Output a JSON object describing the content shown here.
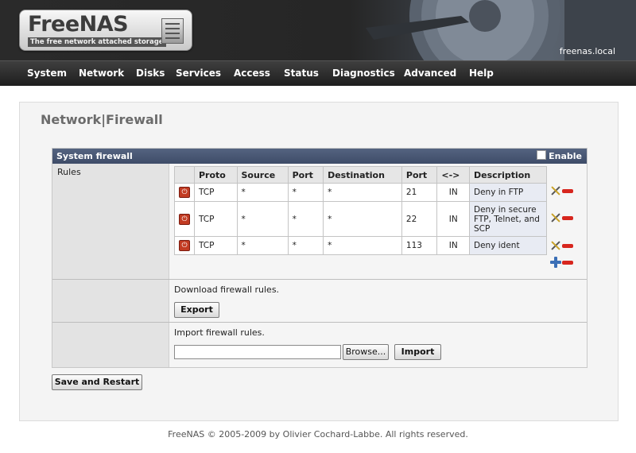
{
  "header": {
    "logo_title": "FreeNAS",
    "logo_subtitle": "The free network attached storage",
    "hostname": "freenas.local"
  },
  "nav": [
    "System",
    "Network",
    "Disks",
    "Services",
    "Access",
    "Status",
    "Diagnostics",
    "Advanced",
    "Help"
  ],
  "page": {
    "title": "Network|Firewall"
  },
  "panel": {
    "title": "System firewall",
    "enable_label": "Enable",
    "enable_checked": false,
    "rules_label": "Rules",
    "columns": [
      "Proto",
      "Source",
      "Port",
      "Destination",
      "Port",
      "<->",
      "Description"
    ],
    "rows": [
      {
        "proto": "TCP",
        "source": "*",
        "sport": "*",
        "destination": "*",
        "dport": "21",
        "dir": "IN",
        "description": "Deny in FTP"
      },
      {
        "proto": "TCP",
        "source": "*",
        "sport": "*",
        "destination": "*",
        "dport": "22",
        "dir": "IN",
        "description": "Deny in secure FTP, Telnet, and SCP"
      },
      {
        "proto": "TCP",
        "source": "*",
        "sport": "*",
        "destination": "*",
        "dport": "113",
        "dir": "IN",
        "description": "Deny ident"
      }
    ],
    "download_text": "Download firewall rules.",
    "export_label": "Export",
    "import_text": "Import firewall rules.",
    "file_value": "",
    "browse_label": "Browse...",
    "import_label": "Import"
  },
  "save_label": "Save and Restart",
  "footer": "FreeNAS © 2005-2009 by Olivier Cochard-Labbe. All rights reserved.",
  "colors": {
    "panel_header": "#4a5875",
    "nav_bg": "#2b2b2b",
    "delete": "#d7261e",
    "add": "#3b6fb6"
  },
  "icons": [
    "power-icon",
    "edit-icon",
    "delete-icon",
    "add-icon"
  ]
}
